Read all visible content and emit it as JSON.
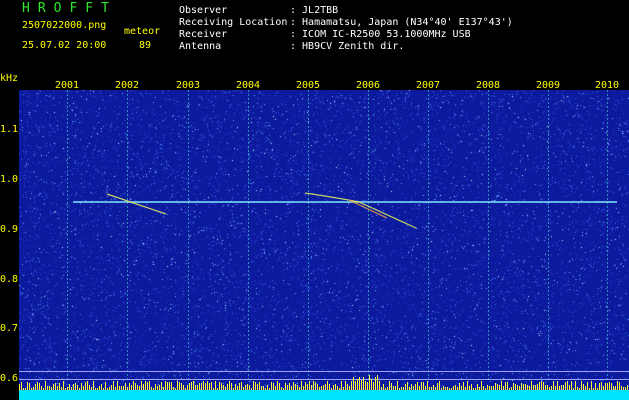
{
  "header": {
    "logo": "HROFFT",
    "filename": "2507022000.png",
    "datetime": "25.07.02 20:00",
    "meteor_label": "meteor",
    "meteor_count": "89"
  },
  "info": {
    "rows": [
      {
        "label": "Observer",
        "value": ": JL2TBB"
      },
      {
        "label": "Receiving Location",
        "value": ": Hamamatsu, Japan (N34°40' E137°43')"
      },
      {
        "label": "Receiver",
        "value": ": ICOM IC-R2500 53.1000MHz USB"
      },
      {
        "label": "Antenna",
        "value": ": HB9CV Zenith dir."
      }
    ]
  },
  "axes": {
    "y_unit": "kHz",
    "x_ticks": [
      "2001",
      "2002",
      "2003",
      "2004",
      "2005",
      "2006",
      "2007",
      "2008",
      "2009",
      "2010"
    ],
    "y_ticks": [
      "1.1",
      "1.0",
      "0.9",
      "0.8",
      "0.7",
      "0.6"
    ]
  },
  "colors": {
    "background": "#000000",
    "spectrogram_base": "#0c1a9e",
    "grid": "#2fa8b8",
    "carrier": "#7fe6ff",
    "label_yellow": "#ffff00",
    "label_white": "#ffffff",
    "logo_green": "#2ee62e",
    "level_cyan": "#00e5ff",
    "level_yellow": "#ffff33"
  }
}
